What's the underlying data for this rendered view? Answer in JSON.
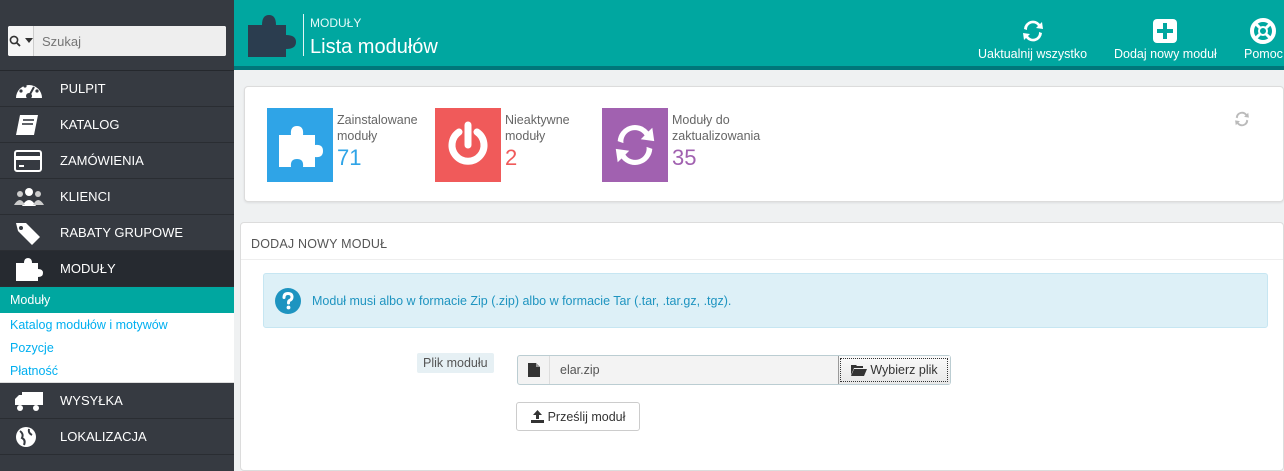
{
  "search": {
    "placeholder": "Szukaj"
  },
  "sidebar": {
    "items": [
      {
        "label": "PULPIT",
        "icon": "dashboard-icon"
      },
      {
        "label": "KATALOG",
        "icon": "book-icon"
      },
      {
        "label": "ZAMÓWIENIA",
        "icon": "credit-card-icon"
      },
      {
        "label": "KLIENCI",
        "icon": "users-icon"
      },
      {
        "label": "RABATY GRUPOWE",
        "icon": "tags-icon"
      },
      {
        "label": "MODUŁY",
        "icon": "puzzle-icon"
      }
    ],
    "submenu": [
      {
        "label": "Moduły"
      },
      {
        "label": "Katalog modułów i motywów"
      },
      {
        "label": "Pozycje"
      },
      {
        "label": "Płatność"
      }
    ],
    "items_after": [
      {
        "label": "WYSYŁKA",
        "icon": "truck-icon"
      },
      {
        "label": "LOKALIZACJA",
        "icon": "globe-icon"
      }
    ]
  },
  "header": {
    "breadcrumb": "MODUŁY",
    "title": "Lista modułów",
    "toolbar": {
      "update_all": "Uaktualnij wszystko",
      "add_module": "Dodaj nowy moduł",
      "help": "Pomoc"
    }
  },
  "kpis": [
    {
      "label_line1": "Zainstalowane",
      "label_line2": "moduły",
      "value": "71",
      "color": "#2fa4e7"
    },
    {
      "label_line1": "Nieaktywne",
      "label_line2": "moduły",
      "value": "2",
      "color": "#f05a5a"
    },
    {
      "label_line1": "Moduły do",
      "label_line2": "zaktualizowania",
      "value": "35",
      "color": "#a161b0"
    }
  ],
  "add_module": {
    "heading": "DODAJ NOWY MODUŁ",
    "info": "Moduł musi albo w formacie Zip (.zip) albo w formacie Tar (.tar, .tar.gz, .tgz).",
    "file_label": "Plik modułu",
    "file_name": "elar.zip",
    "choose_label": "Wybierz plik",
    "upload_label": "Prześlij moduł"
  },
  "colors": {
    "accent": "#00a7a0",
    "sidebar_bg": "#363a41",
    "info_text": "#1e94c0"
  }
}
